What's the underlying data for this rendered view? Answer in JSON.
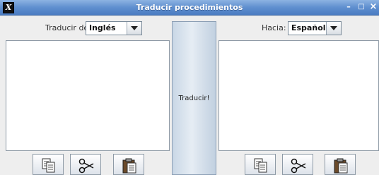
{
  "window": {
    "title": "Traducir procedimientos",
    "icon_glyph": "X",
    "minimize_glyph": "–",
    "maximize_glyph": "□",
    "close_glyph": "×"
  },
  "left": {
    "label": "Traducir de:",
    "selected": "Inglés",
    "text": ""
  },
  "right": {
    "label": "Hacia:",
    "selected": "Español",
    "text": ""
  },
  "translate_label": "Traducir!",
  "icons": {
    "copy": "copy-icon",
    "cut": "cut-icon",
    "paste": "paste-icon"
  }
}
